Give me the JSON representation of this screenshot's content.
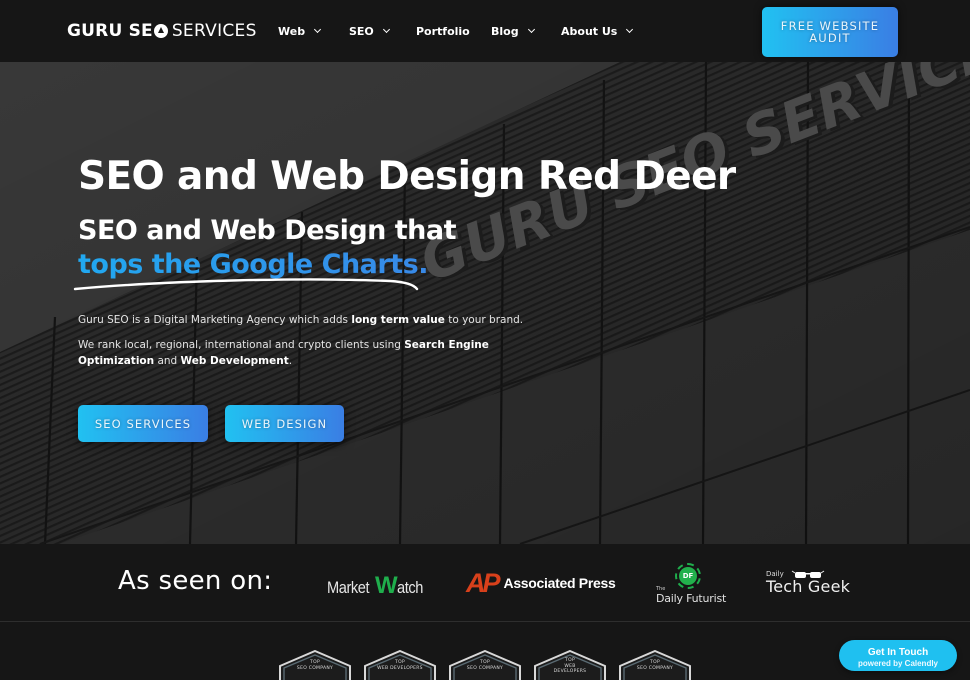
{
  "header": {
    "logo": {
      "bold": "GURU SE",
      "bold_o": "O",
      "light": "SERVICES"
    },
    "nav": [
      {
        "label": "Web",
        "has_dropdown": true
      },
      {
        "label": "SEO",
        "has_dropdown": true
      },
      {
        "label": "Portfolio",
        "has_dropdown": false
      },
      {
        "label": "Blog",
        "has_dropdown": true
      },
      {
        "label": "About Us",
        "has_dropdown": true
      }
    ],
    "cta": {
      "line1": "FREE WEBSITE",
      "line2": "AUDIT"
    }
  },
  "hero": {
    "background_sign_text": "GURU SEO SERVICES",
    "title": "SEO and Web Design Red Deer",
    "subtitle_line1": "SEO and Web Design that",
    "subtitle_line2": "tops the Google Charts.",
    "paragraph1": {
      "before": "Guru SEO is a Digital Marketing Agency which adds ",
      "bold": "long term value",
      "after": " to your brand."
    },
    "paragraph2": {
      "before": "We rank local, regional, international and crypto clients using ",
      "bold1": "Search Engine Optimization",
      "middle": " and ",
      "bold2": "Web Development",
      "after": "."
    },
    "buttons": {
      "seo_services": "SEO SERVICES",
      "web_design": "WEB DESIGN"
    }
  },
  "as_seen_on": {
    "label": "As seen on:",
    "logos": {
      "marketwatch": {
        "pre": "Market",
        "w": "W",
        "post": "atch"
      },
      "ap": {
        "mark": "AP",
        "text": "Associated Press"
      },
      "daily_futurist": {
        "badge": "DF",
        "the": "The",
        "name": "Daily Futurist"
      },
      "tech_geek": {
        "daily": "Daily",
        "name": "Tech Geek"
      }
    }
  },
  "badges": [
    {
      "line1": "TOP",
      "line2": "SEO COMPANY",
      "line3": ""
    },
    {
      "line1": "TOP",
      "line2": "WEB DEVELOPERS",
      "line3": ""
    },
    {
      "line1": "TOP",
      "line2": "SEO COMPANY",
      "line3": ""
    },
    {
      "line1": "TOP",
      "line2": "WEB",
      "line3": "DEVELOPERS"
    },
    {
      "line1": "TOP",
      "line2": "SEO COMPANY",
      "line3": ""
    }
  ],
  "calendly": {
    "title": "Get In Touch",
    "subtitle": "powered by Calendly"
  },
  "colors": {
    "accent_start": "#21c1f1",
    "accent_end": "#3a7ee4",
    "header_bg": "#161616",
    "marketwatch_green": "#1fae4c",
    "ap_red": "#d8401b",
    "calendly_blue": "#1fc0f0"
  }
}
